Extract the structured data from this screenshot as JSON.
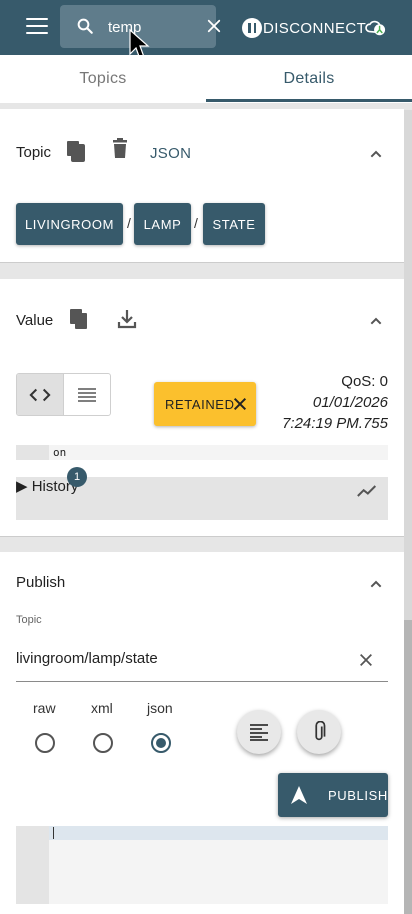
{
  "appbar": {
    "search_value": "temp",
    "disconnect_label": "DISCONNECT"
  },
  "tabs": [
    {
      "label": "Topics",
      "active": false
    },
    {
      "label": "Details",
      "active": true
    }
  ],
  "topic_panel": {
    "title": "Topic",
    "format_link": "JSON",
    "breadcrumbs": [
      "LIVINGROOM",
      "LAMP",
      "STATE"
    ],
    "separator": "/"
  },
  "value_panel": {
    "title": "Value",
    "retained_label": "RETAINED",
    "qos": "QoS: 0",
    "date": "01/01/2026",
    "time": "7:24:19 PM.755",
    "value": "on",
    "history_label": "▶ History",
    "history_count": "1"
  },
  "publish_panel": {
    "title": "Publish",
    "topic_label": "Topic",
    "topic_value": "livingroom/lamp/state",
    "formats": [
      {
        "label": "raw",
        "checked": false
      },
      {
        "label": "xml",
        "checked": false
      },
      {
        "label": "json",
        "checked": true
      }
    ],
    "publish_label": "PUBLISH"
  },
  "colors": {
    "primary": "#375a6b",
    "retained": "#fbc02d",
    "background": "#e6e6e6"
  }
}
